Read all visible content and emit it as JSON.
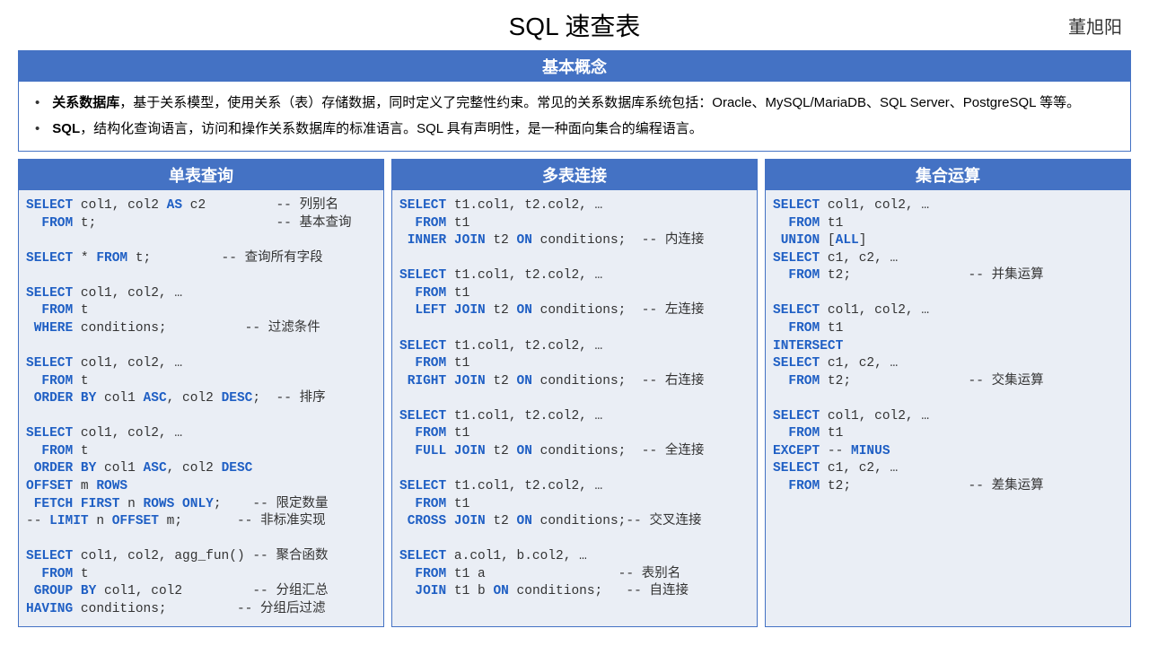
{
  "title": "SQL 速查表",
  "author": "董旭阳",
  "concepts": {
    "header": "基本概念",
    "item1_bold": "关系数据库",
    "item1_rest": "，基于关系模型，使用关系（表）存储数据，同时定义了完整性约束。常见的关系数据库系统包括：Oracle、MySQL/MariaDB、SQL Server、PostgreSQL 等等。",
    "item2_bold": "SQL",
    "item2_rest": "，结构化查询语言，访问和操作关系数据库的标准语言。SQL 具有声明性，是一种面向集合的编程语言。"
  },
  "col1": {
    "header": "单表查询",
    "code": "<span class=\"kw\">SELECT</span> col1, col2 <span class=\"kw\">AS</span> c2         -- 列别名\n  <span class=\"kw\">FROM</span> t;                       -- 基本查询\n\n<span class=\"kw\">SELECT</span> * <span class=\"kw\">FROM</span> t;         -- 查询所有字段\n\n<span class=\"kw\">SELECT</span> col1, col2, …\n  <span class=\"kw\">FROM</span> t\n <span class=\"kw\">WHERE</span> conditions;          -- 过滤条件\n\n<span class=\"kw\">SELECT</span> col1, col2, …\n  <span class=\"kw\">FROM</span> t\n <span class=\"kw\">ORDER BY</span> col1 <span class=\"kw\">ASC</span>, col2 <span class=\"kw\">DESC</span>;  -- 排序\n\n<span class=\"kw\">SELECT</span> col1, col2, …\n  <span class=\"kw\">FROM</span> t\n <span class=\"kw\">ORDER BY</span> col1 <span class=\"kw\">ASC</span>, col2 <span class=\"kw\">DESC</span>\n<span class=\"kw\">OFFSET</span> m <span class=\"kw\">ROWS</span>\n <span class=\"kw\">FETCH FIRST</span> n <span class=\"kw\">ROWS ONLY</span>;    -- 限定数量\n-- <span class=\"kw\">LIMIT</span> n <span class=\"kw\">OFFSET</span> m;       -- 非标准实现\n\n<span class=\"kw\">SELECT</span> col1, col2, agg_fun() -- 聚合函数\n  <span class=\"kw\">FROM</span> t\n <span class=\"kw\">GROUP BY</span> col1, col2         -- 分组汇总\n<span class=\"kw\">HAVING</span> conditions;         -- 分组后过滤"
  },
  "col2": {
    "header": "多表连接",
    "code": "<span class=\"kw\">SELECT</span> t1.col1, t2.col2, …\n  <span class=\"kw\">FROM</span> t1\n <span class=\"kw\">INNER JOIN</span> t2 <span class=\"kw\">ON</span> conditions;  -- 内连接\n\n<span class=\"kw\">SELECT</span> t1.col1, t2.col2, …\n  <span class=\"kw\">FROM</span> t1\n  <span class=\"kw\">LEFT JOIN</span> t2 <span class=\"kw\">ON</span> conditions;  -- 左连接\n\n<span class=\"kw\">SELECT</span> t1.col1, t2.col2, …\n  <span class=\"kw\">FROM</span> t1\n <span class=\"kw\">RIGHT JOIN</span> t2 <span class=\"kw\">ON</span> conditions;  -- 右连接\n\n<span class=\"kw\">SELECT</span> t1.col1, t2.col2, …\n  <span class=\"kw\">FROM</span> t1\n  <span class=\"kw\">FULL JOIN</span> t2 <span class=\"kw\">ON</span> conditions;  -- 全连接\n\n<span class=\"kw\">SELECT</span> t1.col1, t2.col2, …\n  <span class=\"kw\">FROM</span> t1\n <span class=\"kw\">CROSS JOIN</span> t2 <span class=\"kw\">ON</span> conditions;-- 交叉连接\n\n<span class=\"kw\">SELECT</span> a.col1, b.col2, …\n  <span class=\"kw\">FROM</span> t1 a                 -- 表别名\n  <span class=\"kw\">JOIN</span> t1 b <span class=\"kw\">ON</span> conditions;   -- 自连接"
  },
  "col3": {
    "header": "集合运算",
    "code": "<span class=\"kw\">SELECT</span> col1, col2, …\n  <span class=\"kw\">FROM</span> t1\n <span class=\"kw\">UNION</span> [<span class=\"kw\">ALL</span>]\n<span class=\"kw\">SELECT</span> c1, c2, …\n  <span class=\"kw\">FROM</span> t2;               -- 并集运算\n\n<span class=\"kw\">SELECT</span> col1, col2, …\n  <span class=\"kw\">FROM</span> t1\n<span class=\"kw\">INTERSECT</span>\n<span class=\"kw\">SELECT</span> c1, c2, …\n  <span class=\"kw\">FROM</span> t2;               -- 交集运算\n\n<span class=\"kw\">SELECT</span> col1, col2, …\n  <span class=\"kw\">FROM</span> t1\n<span class=\"kw\">EXCEPT</span> -- <span class=\"kw\">MINUS</span>\n<span class=\"kw\">SELECT</span> c1, c2, …\n  <span class=\"kw\">FROM</span> t2;               -- 差集运算"
  }
}
